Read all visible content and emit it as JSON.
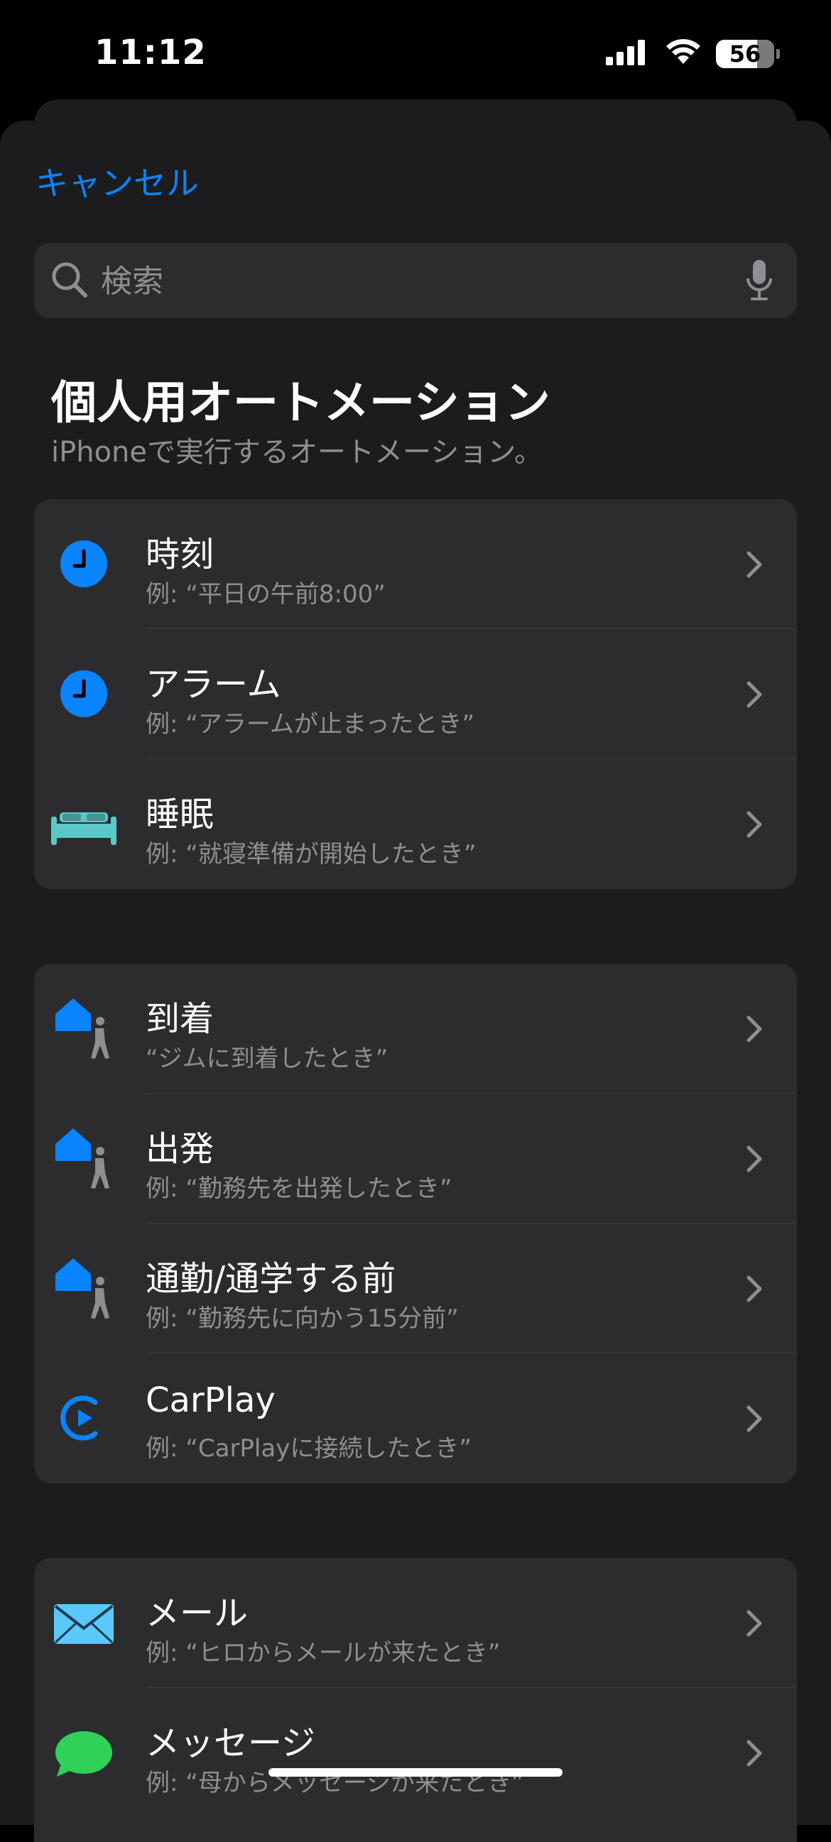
{
  "status": {
    "time": "11:12",
    "battery": "56"
  },
  "cancel_label": "キャンセル",
  "search": {
    "placeholder": "検索"
  },
  "header": {
    "title": "個人用オートメーション",
    "subtitle": "iPhoneで実行するオートメーション。"
  },
  "groups": [
    {
      "rows": [
        {
          "icon": "clock-icon",
          "label": "時刻",
          "description": "例: “平日の午前8:00”"
        },
        {
          "icon": "clock-icon",
          "label": "アラーム",
          "description": "例: “アラームが止まったとき”"
        },
        {
          "icon": "bed-icon",
          "label": "睡眠",
          "description": "例: “就寝準備が開始したとき”"
        }
      ]
    },
    {
      "rows": [
        {
          "icon": "home-person-icon",
          "label": "到着",
          "description": "“ジムに到着したとき”"
        },
        {
          "icon": "home-person-icon",
          "label": "出発",
          "description": "例: “勤務先を出発したとき”"
        },
        {
          "icon": "home-person-icon",
          "label": "通勤/通学する前",
          "description": "例: “勤務先に向かう15分前”"
        },
        {
          "icon": "carplay-icon",
          "label": "CarPlay",
          "description": "例: “CarPlayに接続したとき”"
        }
      ]
    },
    {
      "rows": [
        {
          "icon": "mail-icon",
          "label": "メール",
          "description": "例: “ヒロからメールが来たとき”"
        },
        {
          "icon": "message-icon",
          "label": "メッセージ",
          "description": "例: “母からメッセージが来たとき”"
        }
      ]
    }
  ],
  "colors": {
    "accent": "#0a84ff",
    "sheet": "#1c1c1e",
    "card": "#2c2c2e",
    "secondary_text": "#8e8e93",
    "bed": "#5ac8c8",
    "message": "#30d158",
    "mail": "#5ac8fa"
  }
}
